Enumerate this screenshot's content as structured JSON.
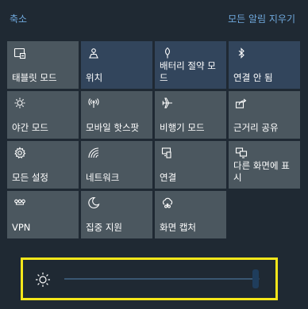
{
  "header": {
    "collapse_label": "축소",
    "clear_all_label": "모든 알림 지우기"
  },
  "tiles": [
    {
      "label": "태블릿 모드",
      "icon": "tablet-mode-icon",
      "active": false
    },
    {
      "label": "위치",
      "icon": "location-icon",
      "active": true
    },
    {
      "label": "배터리 절약 모드",
      "icon": "battery-saver-icon",
      "active": true
    },
    {
      "label": "연결 안 됨",
      "icon": "bluetooth-icon",
      "active": true
    },
    {
      "label": "야간 모드",
      "icon": "night-light-icon",
      "active": false
    },
    {
      "label": "모바일 핫스팟",
      "icon": "mobile-hotspot-icon",
      "active": false
    },
    {
      "label": "비행기 모드",
      "icon": "airplane-icon",
      "active": false
    },
    {
      "label": "근거리 공유",
      "icon": "nearby-share-icon",
      "active": false
    },
    {
      "label": "모든 설정",
      "icon": "gear-icon",
      "active": false
    },
    {
      "label": "네트워크",
      "icon": "network-icon",
      "active": false
    },
    {
      "label": "연결",
      "icon": "connect-icon",
      "active": false
    },
    {
      "label": "다른 화면에 표시",
      "icon": "project-icon",
      "active": false
    },
    {
      "label": "VPN",
      "icon": "vpn-icon",
      "active": false
    },
    {
      "label": "집중 지원",
      "icon": "focus-assist-icon",
      "active": false
    },
    {
      "label": "화면 캡처",
      "icon": "screen-snip-icon",
      "active": false
    }
  ],
  "brightness": {
    "icon": "brightness-sun-icon",
    "level": 0.98
  },
  "colors": {
    "background": "#1f2933",
    "tile_off": "#4b575f",
    "tile_on": "#32455c",
    "link": "#6fa8dc",
    "highlight_border": "#f5e71a"
  }
}
